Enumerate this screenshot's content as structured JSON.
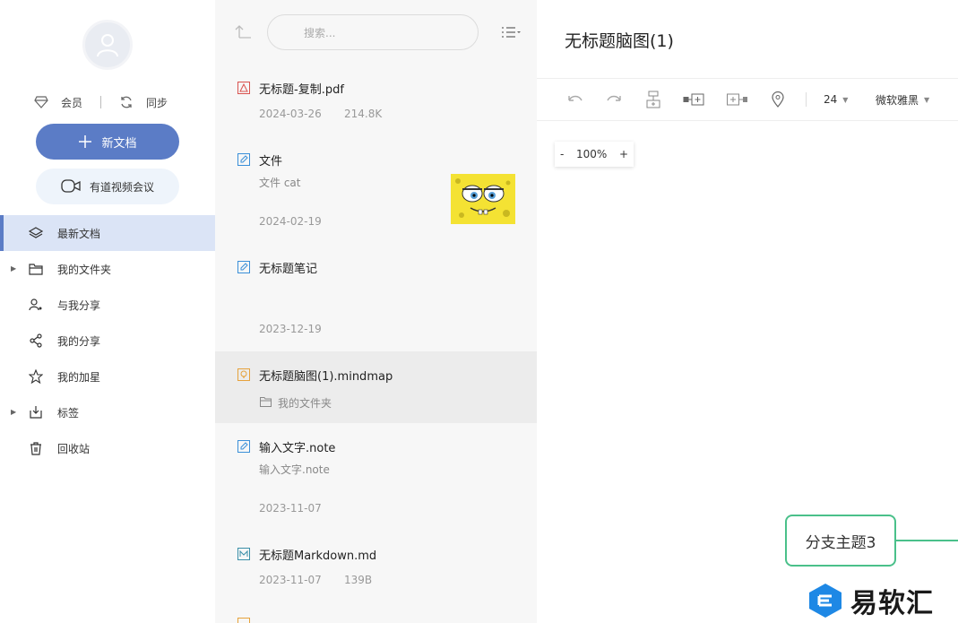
{
  "sidebar": {
    "vip_label": "会员",
    "sync_label": "同步",
    "new_doc_label": "新文档",
    "meeting_label": "有道视频会议",
    "nav": [
      {
        "label": "最新文档",
        "icon": "layers-icon",
        "active": true
      },
      {
        "label": "我的文件夹",
        "icon": "folder-icon",
        "expandable": true
      },
      {
        "label": "与我分享",
        "icon": "shared-users-icon"
      },
      {
        "label": "我的分享",
        "icon": "share-icon"
      },
      {
        "label": "我的加星",
        "icon": "star-icon"
      },
      {
        "label": "标签",
        "icon": "tag-icon",
        "expandable": true
      },
      {
        "label": "回收站",
        "icon": "trash-icon"
      }
    ]
  },
  "list": {
    "search_placeholder": "搜索...",
    "files": [
      {
        "name": "无标题-复制.pdf",
        "icon": "pdf-icon",
        "date": "2024-03-26",
        "size": "214.8K"
      },
      {
        "name": "文件",
        "icon": "note-icon",
        "sub": "文件 cat",
        "date": "2024-02-19",
        "thumbnail": "spongebob-image"
      },
      {
        "name": "无标题笔记",
        "icon": "note-icon",
        "date": "2023-12-19"
      },
      {
        "name": "无标题脑图(1).mindmap",
        "icon": "mindmap-icon",
        "folder": "我的文件夹",
        "selected": true
      },
      {
        "name": "输入文字.note",
        "icon": "note-icon",
        "sub": "输入文字.note",
        "date": "2023-11-07"
      },
      {
        "name": "无标题Markdown.md",
        "icon": "markdown-icon",
        "date": "2023-11-07",
        "size": "139B"
      }
    ]
  },
  "editor": {
    "title": "无标题脑图(1)",
    "font_size": "24",
    "font_family": "微软雅黑",
    "zoom_minus": "-",
    "zoom_value": "100%",
    "zoom_plus": "+",
    "node_label": "分支主题3"
  },
  "watermark": {
    "text": "易软汇"
  },
  "colors": {
    "accent": "#5b7cc6",
    "node_border": "#4ac08a",
    "active_nav": "#dbe4f6"
  }
}
